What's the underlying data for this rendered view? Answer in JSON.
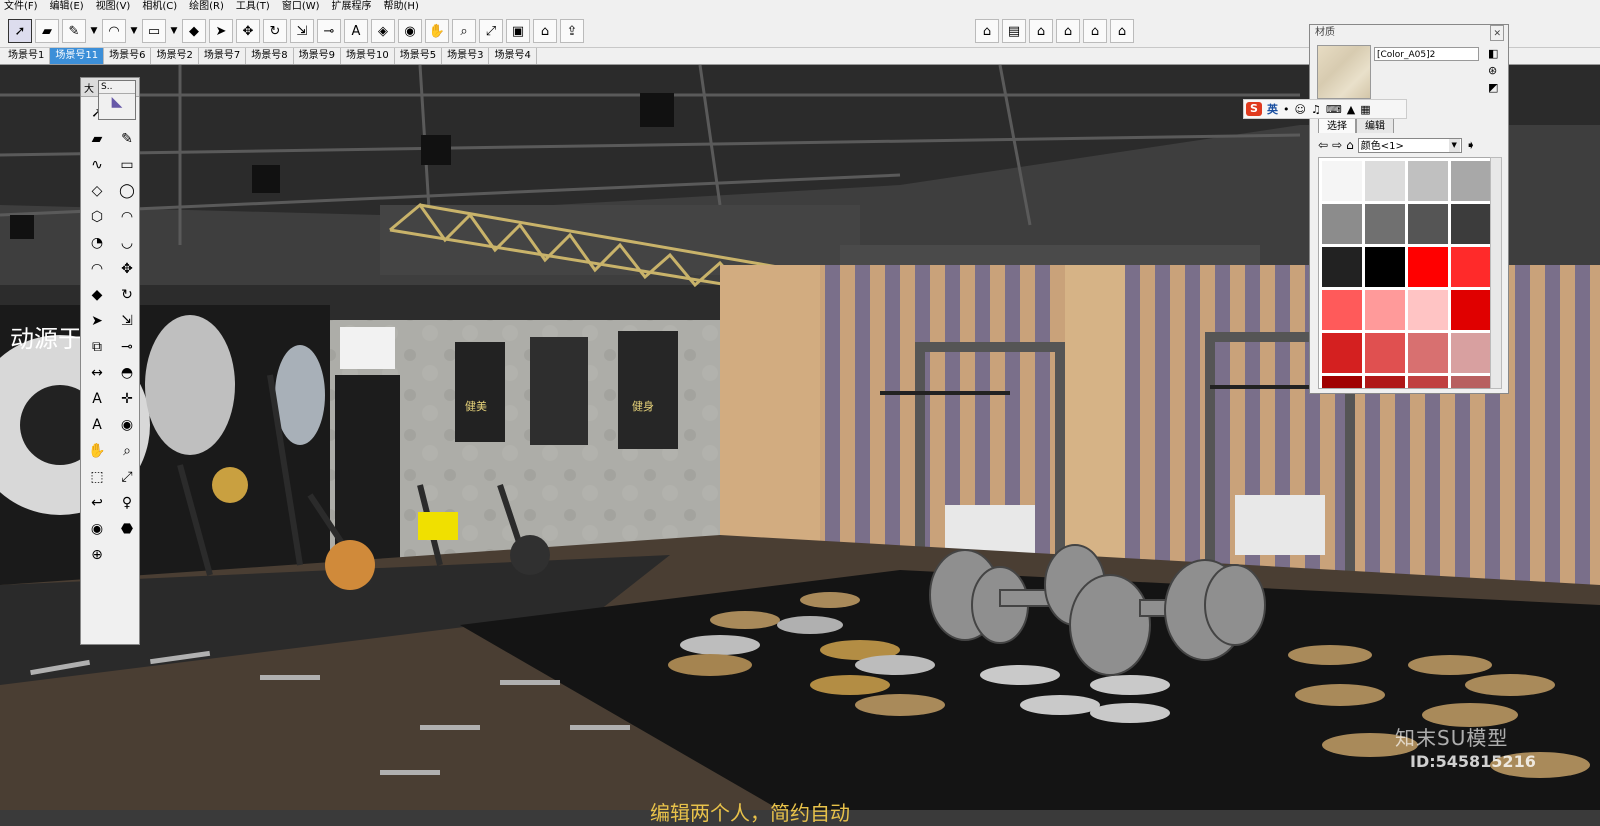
{
  "menu": [
    "文件(F)",
    "编辑(E)",
    "视图(V)",
    "相机(C)",
    "绘图(R)",
    "工具(T)",
    "窗口(W)",
    "扩展程序",
    "帮助(H)"
  ],
  "scene_tabs": [
    "场景号1",
    "场景号11",
    "场景号6",
    "场景号2",
    "场景号7",
    "场景号8",
    "场景号9",
    "场景号10",
    "场景号5",
    "场景号3",
    "场景号4"
  ],
  "active_tab_index": 1,
  "toolbar_icons": [
    "select-icon",
    "eraser-icon",
    "pencil-icon",
    "arc-icon",
    "rectangle-icon",
    "push-pull-icon",
    "follow-me-icon",
    "move-icon",
    "rotate-icon",
    "scale-icon",
    "tape-measure-icon",
    "text-icon",
    "paint-bucket-icon",
    "orbit-icon",
    "pan-icon",
    "zoom-icon",
    "zoom-extents-icon",
    "components-icon",
    "3d-warehouse-icon",
    "extension-icon"
  ],
  "view_icons": [
    "iso-view-icon",
    "top-view-icon",
    "front-view-icon",
    "right-view-icon",
    "back-view-icon",
    "left-view-icon"
  ],
  "tool_palette": {
    "title": "大",
    "popup_label": "S..",
    "icons": [
      "select-icon",
      "paint-bucket-icon",
      "eraser-icon",
      "pencil-icon",
      "freehand-icon",
      "rectangle-icon",
      "rotated-rectangle-icon",
      "circle-icon",
      "polygon-icon",
      "arc-icon",
      "pie-icon",
      "two-point-arc-icon",
      "three-point-arc-icon",
      "move-icon",
      "push-pull-icon",
      "rotate-icon",
      "follow-me-icon",
      "scale-icon",
      "offset-icon",
      "tape-measure-icon",
      "dimension-icon",
      "protractor-icon",
      "text-icon",
      "axes-icon",
      "3d-text-icon",
      "orbit-icon",
      "pan-icon",
      "zoom-icon",
      "zoom-window-icon",
      "zoom-extents-icon",
      "previous-view-icon",
      "position-camera-icon",
      "look-around-icon",
      "walk-icon",
      "section-plane-icon"
    ]
  },
  "material_panel": {
    "title": "材质",
    "material_name": "[Color_A05]2",
    "tabs": [
      "选择",
      "编辑"
    ],
    "library": "颜色<1>",
    "swatches": [
      "#f5f5f5",
      "#dcdcdc",
      "#c0c0c0",
      "#a8a8a8",
      "#8c8c8c",
      "#707070",
      "#555555",
      "#3c3c3c",
      "#222222",
      "#000000",
      "#ff0000",
      "#ff2a2a",
      "#ff5a5a",
      "#ff9a9a",
      "#ffc4c4",
      "#e00000",
      "#d42020",
      "#e05050",
      "#d87070",
      "#d8a0a0",
      "#a00000",
      "#b01818",
      "#c04040",
      "#b86060"
    ]
  },
  "ime": {
    "logo": "S",
    "label": "英"
  },
  "scene": {
    "left_banner_text": "动源于",
    "poster_titles": [
      "健美",
      "健身"
    ]
  },
  "watermark": {
    "brand": "知末SU模型",
    "id": "ID:545815216"
  },
  "subtitle": "编辑两个人，简约自动"
}
